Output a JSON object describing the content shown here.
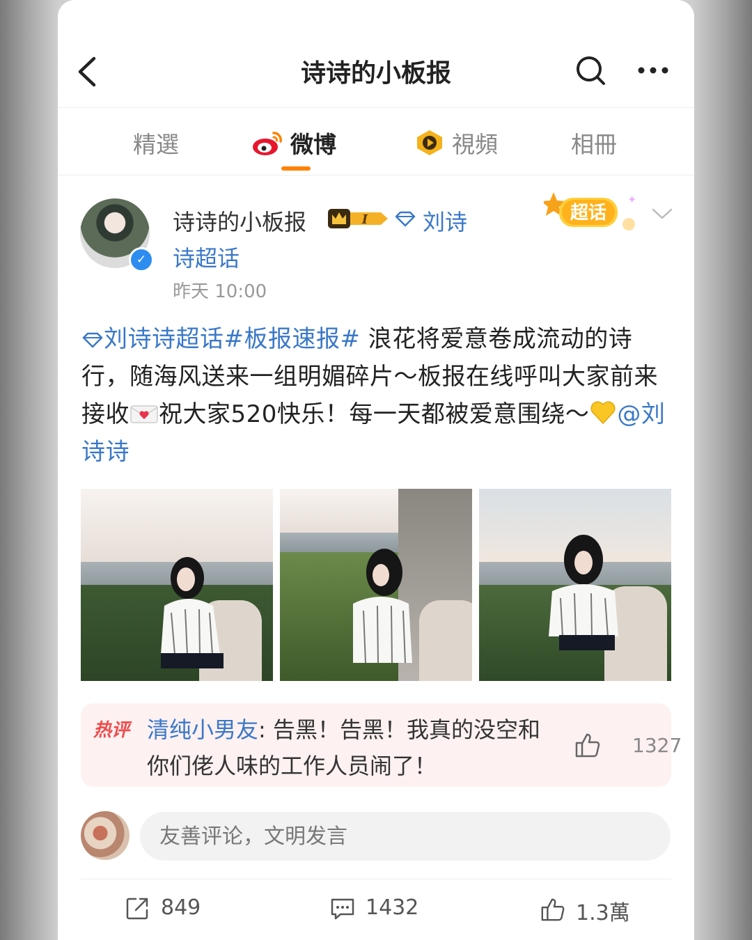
{
  "header": {
    "title": "诗诗的小板报"
  },
  "tabs": [
    {
      "label": "精選"
    },
    {
      "label": "微博"
    },
    {
      "label": "視頻"
    },
    {
      "label": "相冊"
    }
  ],
  "post": {
    "author": "诗诗的小板报",
    "level_badge": "I",
    "topic_line1": "刘诗",
    "topic_line2": "诗超话",
    "time": "昨天 10:00",
    "supertopic_badge": "超话",
    "content": {
      "hashtags": "刘诗诗超话#板报速报#",
      "text1": " 浪花将爱意卷成流动的诗行，随海风送来一组明媚碎片～板报在线呼叫大家前来接收",
      "text2": "祝大家520快乐！每一天都被爱意围绕～",
      "mention": "@刘诗诗"
    },
    "photos": [
      {
        "name": "photo-1"
      },
      {
        "name": "photo-2"
      },
      {
        "name": "photo-3"
      }
    ]
  },
  "hot_comment": {
    "tag": "热评",
    "user": "清纯小男友",
    "text": ": 告黑！告黑！我真的没空和你们佬人味的工作人员闹了！",
    "likes": "1327"
  },
  "comment_input": {
    "placeholder": "友善评论，文明发言"
  },
  "actions": {
    "reposts": "849",
    "comments": "1432",
    "likes": "1.3萬"
  },
  "colors": {
    "accent": "#ff8200",
    "link": "#3a78c8",
    "hot": "#f04b4b"
  }
}
